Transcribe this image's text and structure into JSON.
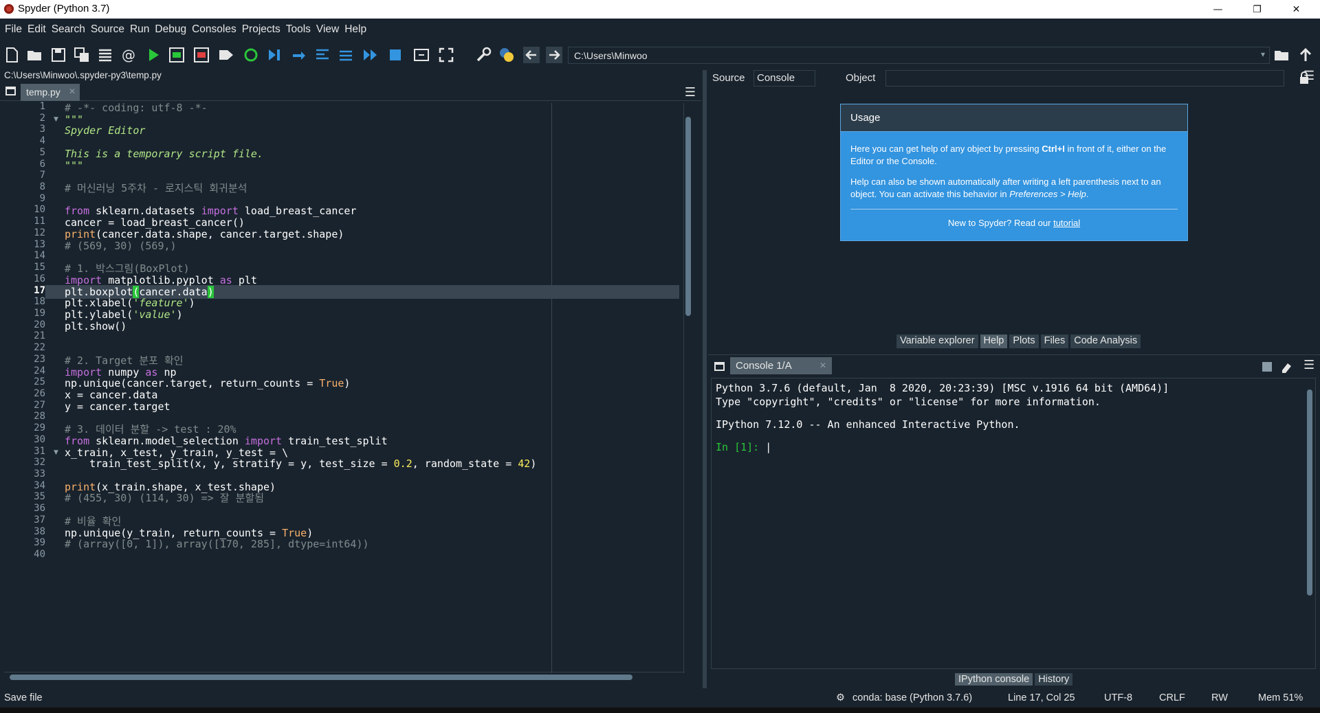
{
  "window": {
    "title": "Spyder (Python 3.7)",
    "controls": [
      "—",
      "❐",
      "✕"
    ]
  },
  "menu": [
    "File",
    "Edit",
    "Search",
    "Source",
    "Run",
    "Debug",
    "Consoles",
    "Projects",
    "Tools",
    "View",
    "Help"
  ],
  "toolbar": {
    "working_dir": "C:\\Users\\Minwoo"
  },
  "editor": {
    "file_path": "C:\\Users\\Minwoo\\.spyder-py3\\temp.py",
    "tab_label": "temp.py",
    "current_line": 17,
    "line_numbers": [
      "1",
      "2",
      "3",
      "4",
      "5",
      "6",
      "7",
      "8",
      "9",
      "10",
      "11",
      "12",
      "13",
      "14",
      "15",
      "16",
      "17",
      "18",
      "19",
      "20",
      "21",
      "22",
      "23",
      "24",
      "25",
      "26",
      "27",
      "28",
      "29",
      "30",
      "31",
      "32",
      "33",
      "34",
      "35",
      "36",
      "37",
      "38",
      "39",
      "40"
    ],
    "lines": [
      "# -*- coding: utf-8 -*-",
      "\"\"\"",
      "Spyder Editor",
      "",
      "This is a temporary script file.",
      "\"\"\"",
      "",
      "# 머신러닝 5주차 - 로지스틱 회귀분석",
      "",
      "from sklearn.datasets import load_breast_cancer",
      "cancer = load_breast_cancer()",
      "print(cancer.data.shape, cancer.target.shape)",
      "# (569, 30) (569,)",
      "",
      "# 1. 박스그림(BoxPlot)",
      "import matplotlib.pyplot as plt",
      "plt.boxplot(cancer.data)",
      "plt.xlabel('feature')",
      "plt.ylabel('value')",
      "plt.show()",
      "",
      "",
      "# 2. Target 분포 확인",
      "import numpy as np",
      "np.unique(cancer.target, return_counts = True)",
      "x = cancer.data",
      "y = cancer.target",
      "",
      "# 3. 데이터 분할 -> test : 20%",
      "from sklearn.model_selection import train_test_split",
      "x_train, x_test, y_train, y_test = \\",
      "    train_test_split(x, y, stratify = y, test_size = 0.2, random_state = 42)",
      "",
      "print(x_train.shape, x_test.shape)",
      "# (455, 30) (114, 30) => 잘 분할됨",
      "",
      "# 비율 확인",
      "np.unique(y_train, return_counts = True)",
      "# (array([0, 1]), array([170, 285], dtype=int64))",
      ""
    ]
  },
  "help": {
    "source_label": "Source",
    "source_value": "Console",
    "object_label": "Object",
    "object_value": "",
    "usage_title": "Usage",
    "usage_p1_a": "Here you can get help of any object by pressing ",
    "usage_p1_key": "Ctrl+I",
    "usage_p1_b": " in front of it, either on the Editor or the Console.",
    "usage_p2_a": "Help can also be shown automatically after writing a left parenthesis next to an object. You can activate this behavior in ",
    "usage_p2_pref": "Preferences > Help",
    "usage_p2_b": ".",
    "new_text": "New to Spyder? Read our ",
    "new_link": "tutorial"
  },
  "pane_tabs": [
    "Variable explorer",
    "Help",
    "Plots",
    "Files",
    "Code Analysis"
  ],
  "console": {
    "tab_label": "Console 1/A",
    "line1": "Python 3.7.6 (default, Jan  8 2020, 20:23:39) [MSC v.1916 64 bit (AMD64)]",
    "line2": "Type \"copyright\", \"credits\" or \"license\" for more information.",
    "line3": "IPython 7.12.0 -- An enhanced Interactive Python.",
    "prompt": "In [1]: "
  },
  "console_tabs": [
    "IPython console",
    "History"
  ],
  "status": {
    "message": "Save file",
    "env": "conda: base (Python 3.7.6)",
    "position": "Line 17, Col 25",
    "encoding": "UTF-8",
    "eol": "CRLF",
    "permissions": "RW",
    "memory": "Mem 51%"
  }
}
